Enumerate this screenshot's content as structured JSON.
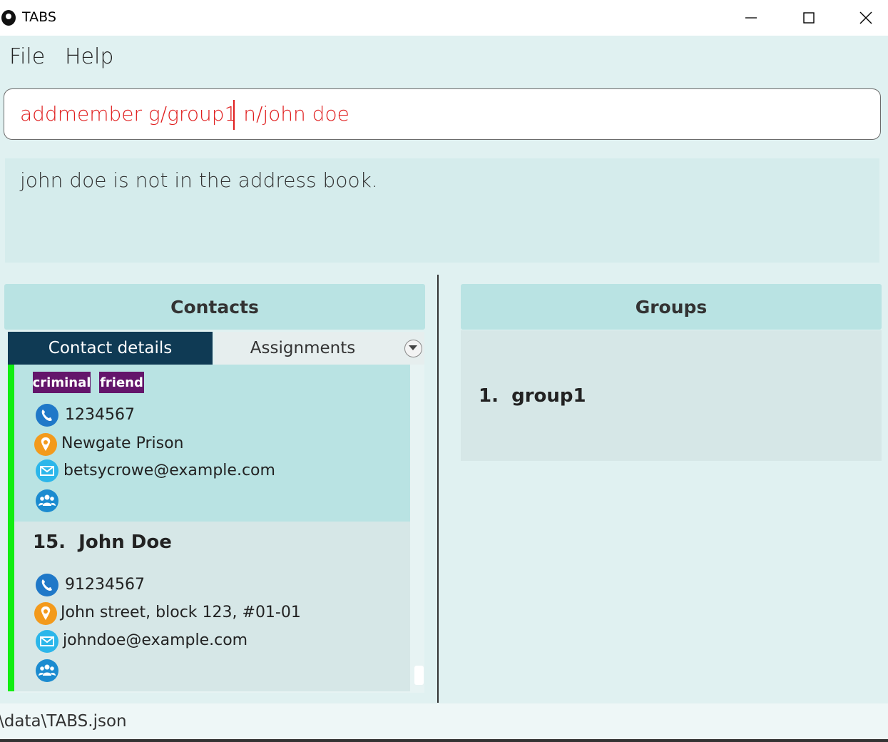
{
  "window": {
    "title": "TABS"
  },
  "menu": {
    "file": "File",
    "help": "Help"
  },
  "command": {
    "value": "addmember g/group1 n/john doe"
  },
  "result": {
    "text": "john doe is not in the address book."
  },
  "contacts": {
    "header": "Contacts",
    "tabs": {
      "active": "Contact details",
      "other": "Assignments"
    },
    "cards": [
      {
        "tags": [
          "criminal",
          "friend"
        ],
        "phone": "1234567",
        "address": "Newgate Prison",
        "email": "betsycrowe@example.com"
      },
      {
        "index": "15.",
        "name": "John Doe",
        "phone": "91234567",
        "address": "John street, block 123, #01-01",
        "email": "johndoe@example.com"
      }
    ]
  },
  "groups": {
    "header": "Groups",
    "items": [
      {
        "index": "1.",
        "name": "group1"
      }
    ]
  },
  "status": {
    "path": "\\data\\TABS.json"
  },
  "colors": {
    "accent_tab": "#0f3a54",
    "tag": "#64156b",
    "command_error": "#e01e1e",
    "panel_header": "#b9e3e3"
  },
  "icons": [
    "phone-icon",
    "location-icon",
    "email-icon",
    "group-icon"
  ]
}
